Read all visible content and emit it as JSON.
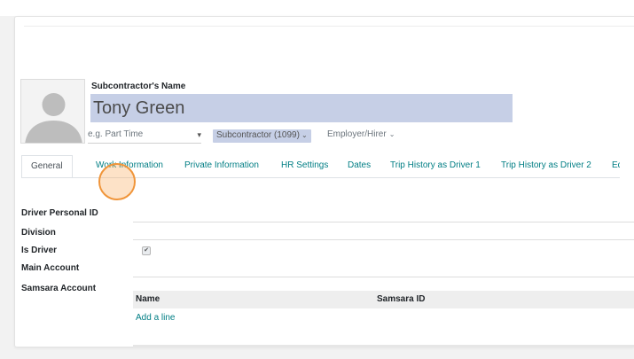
{
  "form": {
    "name_label": "Subcontractor's Name",
    "name_value": "Tony Green",
    "avatar_icon": "person-placeholder-icon",
    "job_placeholder": "e.g. Part Time",
    "job_caret": "▾",
    "contractor_type": "Subcontractor (1099)",
    "employer": "Employer/Hirer",
    "select_chevron": "⌄"
  },
  "tabs": [
    {
      "label": "General",
      "active": true
    },
    {
      "label": "Work Information",
      "active": false
    },
    {
      "label": "Private Information",
      "active": false
    },
    {
      "label": "HR Settings",
      "active": false
    },
    {
      "label": "Dates",
      "active": false
    },
    {
      "label": "Trip History as Driver 1",
      "active": false
    },
    {
      "label": "Trip History as Driver 2",
      "active": false
    },
    {
      "label": "Eq",
      "active": false
    }
  ],
  "fields": {
    "driver_personal_id": "Driver Personal ID",
    "division": "Division",
    "is_driver": "Is Driver",
    "is_driver_checked": true,
    "main_account": "Main Account",
    "samsara_account": "Samsara Account"
  },
  "samsara_table": {
    "columns": [
      "Name",
      "Samsara ID"
    ],
    "add_line": "Add a line"
  },
  "colors": {
    "accent_link": "#017e84",
    "name_field_bg": "#c6cfe6",
    "click_indicator": "#f0953a"
  },
  "check_mark": "✔"
}
